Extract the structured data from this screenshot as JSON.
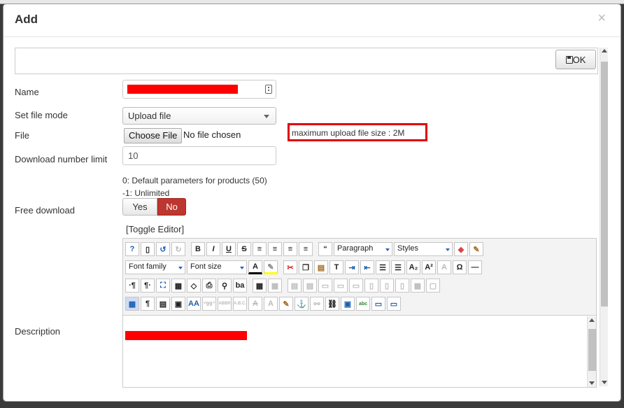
{
  "modal": {
    "title": "Add",
    "close": "×",
    "ok_label": "OK"
  },
  "form": {
    "name_label": "Name",
    "file_mode_label": "Set file mode",
    "file_mode_value": "Upload file",
    "file_label": "File",
    "choose_file": "Choose File",
    "no_file": "No file chosen",
    "max_upload": "maximum upload file size : 2M",
    "download_limit_label": "Download number limit",
    "download_limit_value": "10",
    "hint_default": "0: Default parameters for products (50)",
    "hint_unlimited": "-1: Unlimited",
    "free_download_label": "Free download",
    "yes": "Yes",
    "no": "No",
    "toggle_editor": "[Toggle Editor]",
    "description_label": "Description"
  },
  "editor": {
    "paragraph": "Paragraph",
    "styles": "Styles",
    "font_family": "Font family",
    "font_size": "Font size",
    "btn_bold": "B",
    "btn_italic": "I",
    "btn_underline": "U",
    "btn_strike": "S",
    "btn_quote": "“",
    "btn_omega": "Ω",
    "btn_pilcrow_ltr": "·¶",
    "btn_pilcrow_rtl": "¶·",
    "btn_pilcrow": "¶",
    "btn_ba": "ba",
    "btn_typography": "AA",
    "btn_quotes": "“99”",
    "btn_abbr": "ABBR",
    "btn_acronym": "A.B.C.",
    "btn_ins": "A",
    "btn_del": "A",
    "btn_sub": "A₂",
    "btn_sup": "A²",
    "btn_abc": "abc"
  },
  "colors": {
    "no_active": "#bd362f",
    "highlight_border": "#e00000",
    "redaction": "#ff0000"
  }
}
